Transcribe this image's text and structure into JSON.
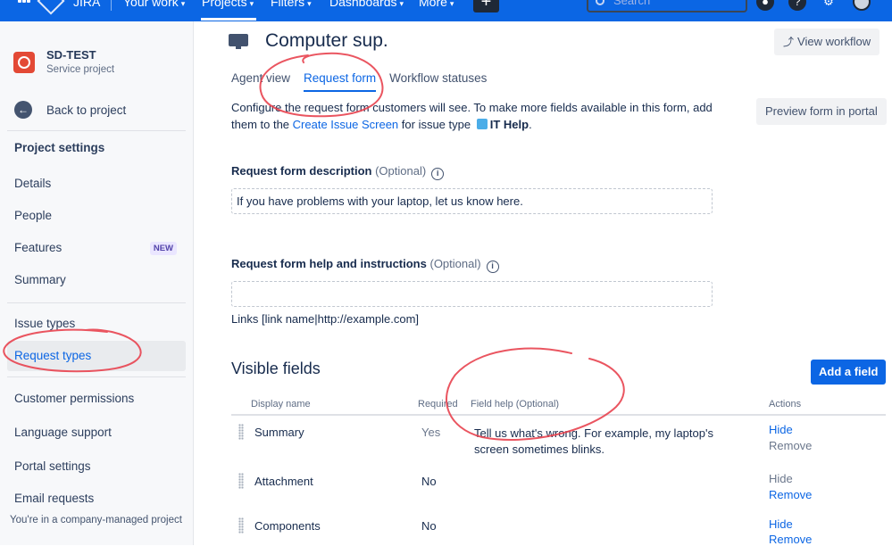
{
  "topbar": {
    "product": "JIRA",
    "nav": [
      "Your work",
      "Projects",
      "Filters",
      "Dashboards",
      "More"
    ],
    "search_placeholder": "Search",
    "create_label": "+",
    "help_label": "?"
  },
  "sidebar": {
    "project_name": "SD-TEST",
    "project_type": "Service project",
    "back_label": "Back to project",
    "settings_heading": "Project settings",
    "items": [
      {
        "label": "Details"
      },
      {
        "label": "People"
      },
      {
        "label": "Features",
        "badge": "NEW"
      },
      {
        "label": "Summary"
      },
      {
        "label": "Issue types"
      },
      {
        "label": "Request types",
        "active": true
      },
      {
        "label": "Customer permissions"
      },
      {
        "label": "Language support"
      },
      {
        "label": "Portal settings"
      },
      {
        "label": "Email requests"
      }
    ],
    "footer": "You're in a company-managed project"
  },
  "main": {
    "title": "Computer sup.",
    "view_workflow": "View workflow",
    "tabs": [
      "Agent view",
      "Request form",
      "Workflow statuses"
    ],
    "active_tab": "Request form",
    "intro": {
      "part1": "Configure the request form customers will see. To make more fields available in this form, add them to the ",
      "link": "Create Issue Screen",
      "part2": " for issue type ",
      "issue_type": "IT Help",
      "part3": "."
    },
    "preview_button": "Preview form in portal",
    "description_label": "Request form description",
    "optional": "(Optional)",
    "description_value": "If you have problems with your laptop, let us know here.",
    "help_label": "Request form help and instructions",
    "help_value": "",
    "links_hint": "Links [link name|http://example.com]",
    "visible_fields_title": "Visible fields",
    "add_field_button": "Add a field",
    "table": {
      "col_display": "Display name",
      "col_required": "Required",
      "col_help": "Field help",
      "col_help_opt": "(Optional)",
      "col_actions": "Actions",
      "rows": [
        {
          "name": "Summary",
          "required": "Yes",
          "help": "Tell us what's wrong. For example, my laptop's screen sometimes blinks.",
          "hide": "Hide",
          "remove": "Remove"
        },
        {
          "name": "Attachment",
          "required": "No",
          "help": "",
          "hide": "Hide",
          "remove": "Remove"
        },
        {
          "name": "Components",
          "required": "No",
          "help": "",
          "hide": "Hide",
          "remove": "Remove"
        }
      ]
    }
  },
  "colors": {
    "topbar": "#0b66e4",
    "link": "#0c66e4",
    "annotation": "#e8424f"
  }
}
